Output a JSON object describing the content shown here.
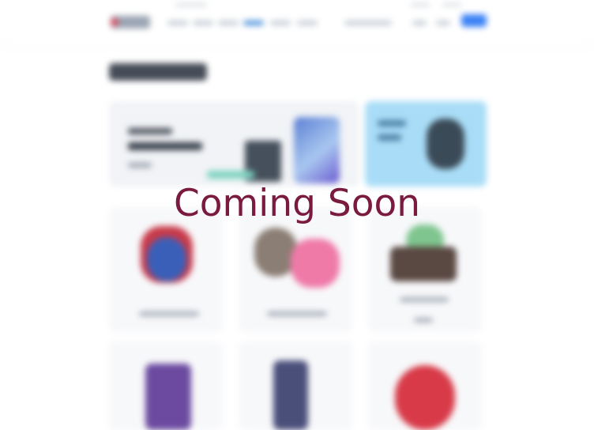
{
  "overlay": {
    "title": "Coming Soon",
    "title_color": "#7a1a3f"
  },
  "background": {
    "blurred": true,
    "accent_color": "#3b82f6",
    "side_banner_color": "#a9ddf7"
  }
}
